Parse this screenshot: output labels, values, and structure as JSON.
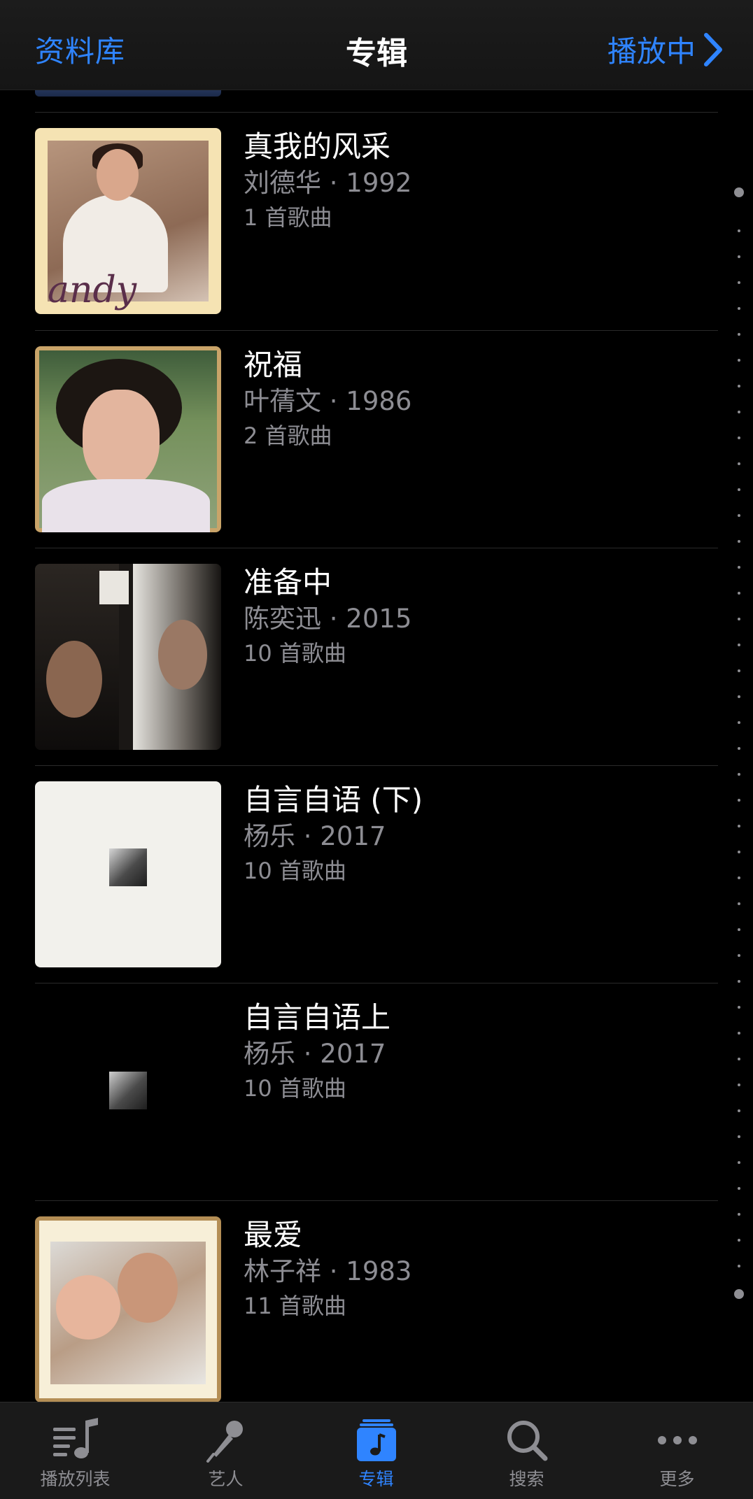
{
  "nav": {
    "back_label": "资料库",
    "title": "专辑",
    "now_playing_label": "播放中"
  },
  "albums": [
    {
      "title": "真我的风采",
      "subtitle": "刘德华 · 1992",
      "count": "1 首歌曲",
      "cover_icon": "album-cover-andy"
    },
    {
      "title": "祝福",
      "subtitle": "叶蒨文 · 1986",
      "count": "2 首歌曲",
      "cover_icon": "album-cover-portrait"
    },
    {
      "title": "准备中",
      "subtitle": "陈奕迅 · 2015",
      "count": "10 首歌曲",
      "cover_icon": "album-cover-collage"
    },
    {
      "title": "自言自语 (下)",
      "subtitle": "杨乐 · 2017",
      "count": "10 首歌曲",
      "cover_icon": "album-cover-white"
    },
    {
      "title": "自言自语上",
      "subtitle": "杨乐 · 2017",
      "count": "10 首歌曲",
      "cover_icon": "album-cover-black"
    },
    {
      "title": "最爱",
      "subtitle": "林子祥 · 1983",
      "count": "11 首歌曲",
      "cover_icon": "album-cover-family"
    }
  ],
  "tabs": [
    {
      "label": "播放列表",
      "icon": "playlist-icon",
      "active": false
    },
    {
      "label": "艺人",
      "icon": "microphone-icon",
      "active": false
    },
    {
      "label": "专辑",
      "icon": "album-icon",
      "active": true
    },
    {
      "label": "搜索",
      "icon": "search-icon",
      "active": false
    },
    {
      "label": "更多",
      "icon": "more-icon",
      "active": false
    }
  ],
  "colors": {
    "accent": "#2f84ff",
    "background": "#000000",
    "secondary_text": "#8d8d93"
  }
}
